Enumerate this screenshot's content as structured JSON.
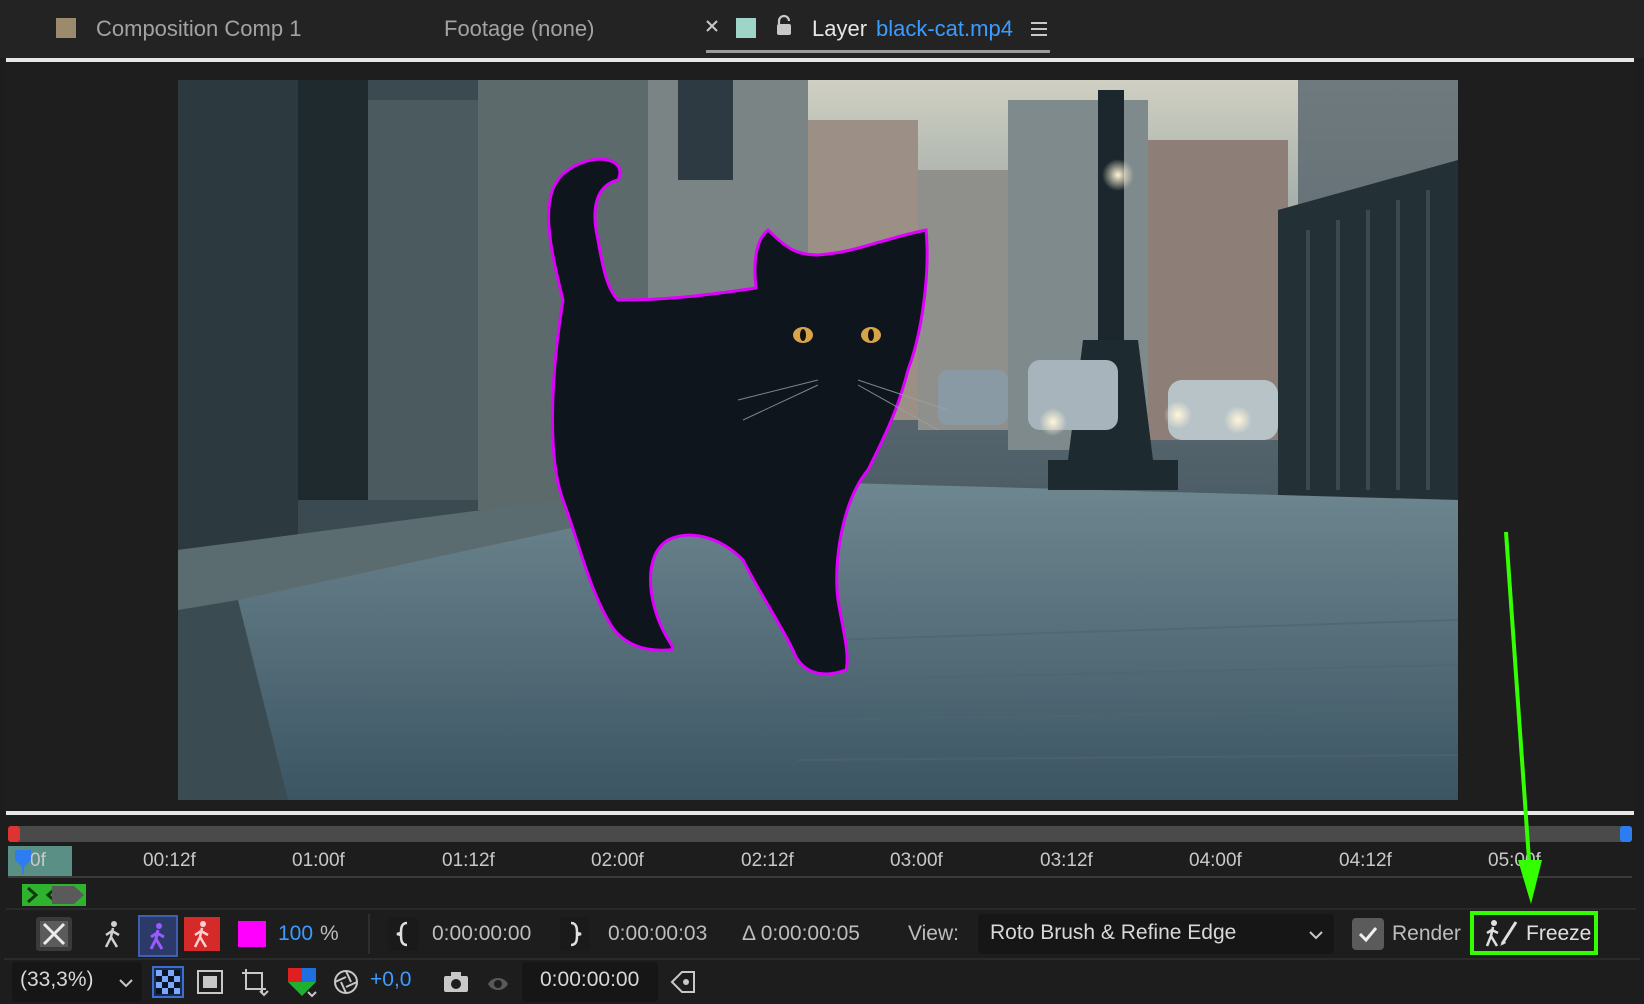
{
  "tabs": [
    {
      "name": "Composition Comp 1",
      "active": false,
      "swatch": "#9c8a6c"
    },
    {
      "name": "Footage (none)",
      "active": false
    },
    {
      "prefix": "Layer",
      "name": "black-cat.mp4",
      "active": true,
      "swatch": "#9fd4c9"
    }
  ],
  "tab_icons": {
    "close": "close-icon",
    "lock": "lock-icon",
    "menu": "hamburger-menu-icon"
  },
  "viewer": {
    "subject": "black cat",
    "outline_color": "#e000ff"
  },
  "timeline": {
    "current_label": "0f",
    "ticks": [
      "00:12f",
      "01:00f",
      "01:12f",
      "02:00f",
      "02:12f",
      "03:00f",
      "03:12f",
      "04:00f",
      "04:12f",
      "05:00f"
    ]
  },
  "toolbar1": {
    "opacity": "100",
    "opacity_unit": "%",
    "in_point": "0:00:00:00",
    "out_point": "0:00:00:03",
    "duration": "Δ 0:00:00:05",
    "view_label": "View:",
    "view_value": "Roto Brush & Refine Edge",
    "render_label": "Render",
    "render_checked": true,
    "freeze_label": "Freeze",
    "mask_color": "#ff00ff"
  },
  "toolbar2": {
    "zoom": "(33,3%)",
    "exposure": "+0,0",
    "timecode": "0:00:00:00"
  },
  "annotation": {
    "color": "#33ff00",
    "target": "Freeze"
  }
}
